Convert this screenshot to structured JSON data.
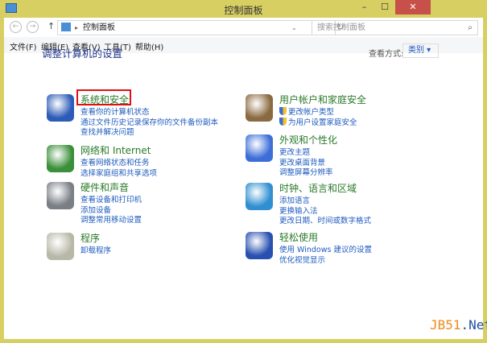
{
  "window": {
    "title": "控制面板",
    "close": "✕",
    "max": "☐",
    "min": "–"
  },
  "nav": {
    "back": "←",
    "forward": "→",
    "up": "↑",
    "address": "控制面板",
    "refresh": "↻",
    "search_placeholder": "搜索控制面板",
    "search_icon": "⌕"
  },
  "menu": [
    "文件(F)",
    "编辑(E)",
    "查看(V)",
    "工具(T)",
    "帮助(H)"
  ],
  "main": {
    "heading": "调整计算机的设置",
    "view_by_label": "查看方式:",
    "view_by_value": "类别 ▾"
  },
  "categories": [
    {
      "title": "系统和安全",
      "links": [
        "查看你的计算机状态",
        "通过文件历史记录保存你的文件备份副本",
        "查找并解决问题"
      ],
      "color": "#2d5bb8"
    },
    {
      "title": "网络和 Internet",
      "links": [
        "查看网络状态和任务",
        "选择家庭组和共享选项"
      ],
      "color": "#3a8f3a"
    },
    {
      "title": "硬件和声音",
      "links": [
        "查看设备和打印机",
        "添加设备",
        "调整常用移动设置"
      ],
      "color": "#7a7f86"
    },
    {
      "title": "程序",
      "links": [
        "卸载程序"
      ],
      "color": "#b8b8a8"
    },
    {
      "title": "用户帐户和家庭安全",
      "links": [
        "更改帐户类型",
        "为用户设置家庭安全"
      ],
      "color": "#8a6a40"
    },
    {
      "title": "外观和个性化",
      "links": [
        "更改主题",
        "更改桌面背景",
        "调整屏幕分辨率"
      ],
      "color": "#3d6ed8"
    },
    {
      "title": "时钟、语言和区域",
      "links": [
        "添加语言",
        "更换输入法",
        "更改日期、时间或数字格式"
      ],
      "color": "#2f8fd0"
    },
    {
      "title": "轻松使用",
      "links": [
        "使用 Windows 建议的设置",
        "优化视觉显示"
      ],
      "color": "#2850b0"
    }
  ],
  "watermark": {
    "a": "JB51",
    "b": ".Net"
  }
}
